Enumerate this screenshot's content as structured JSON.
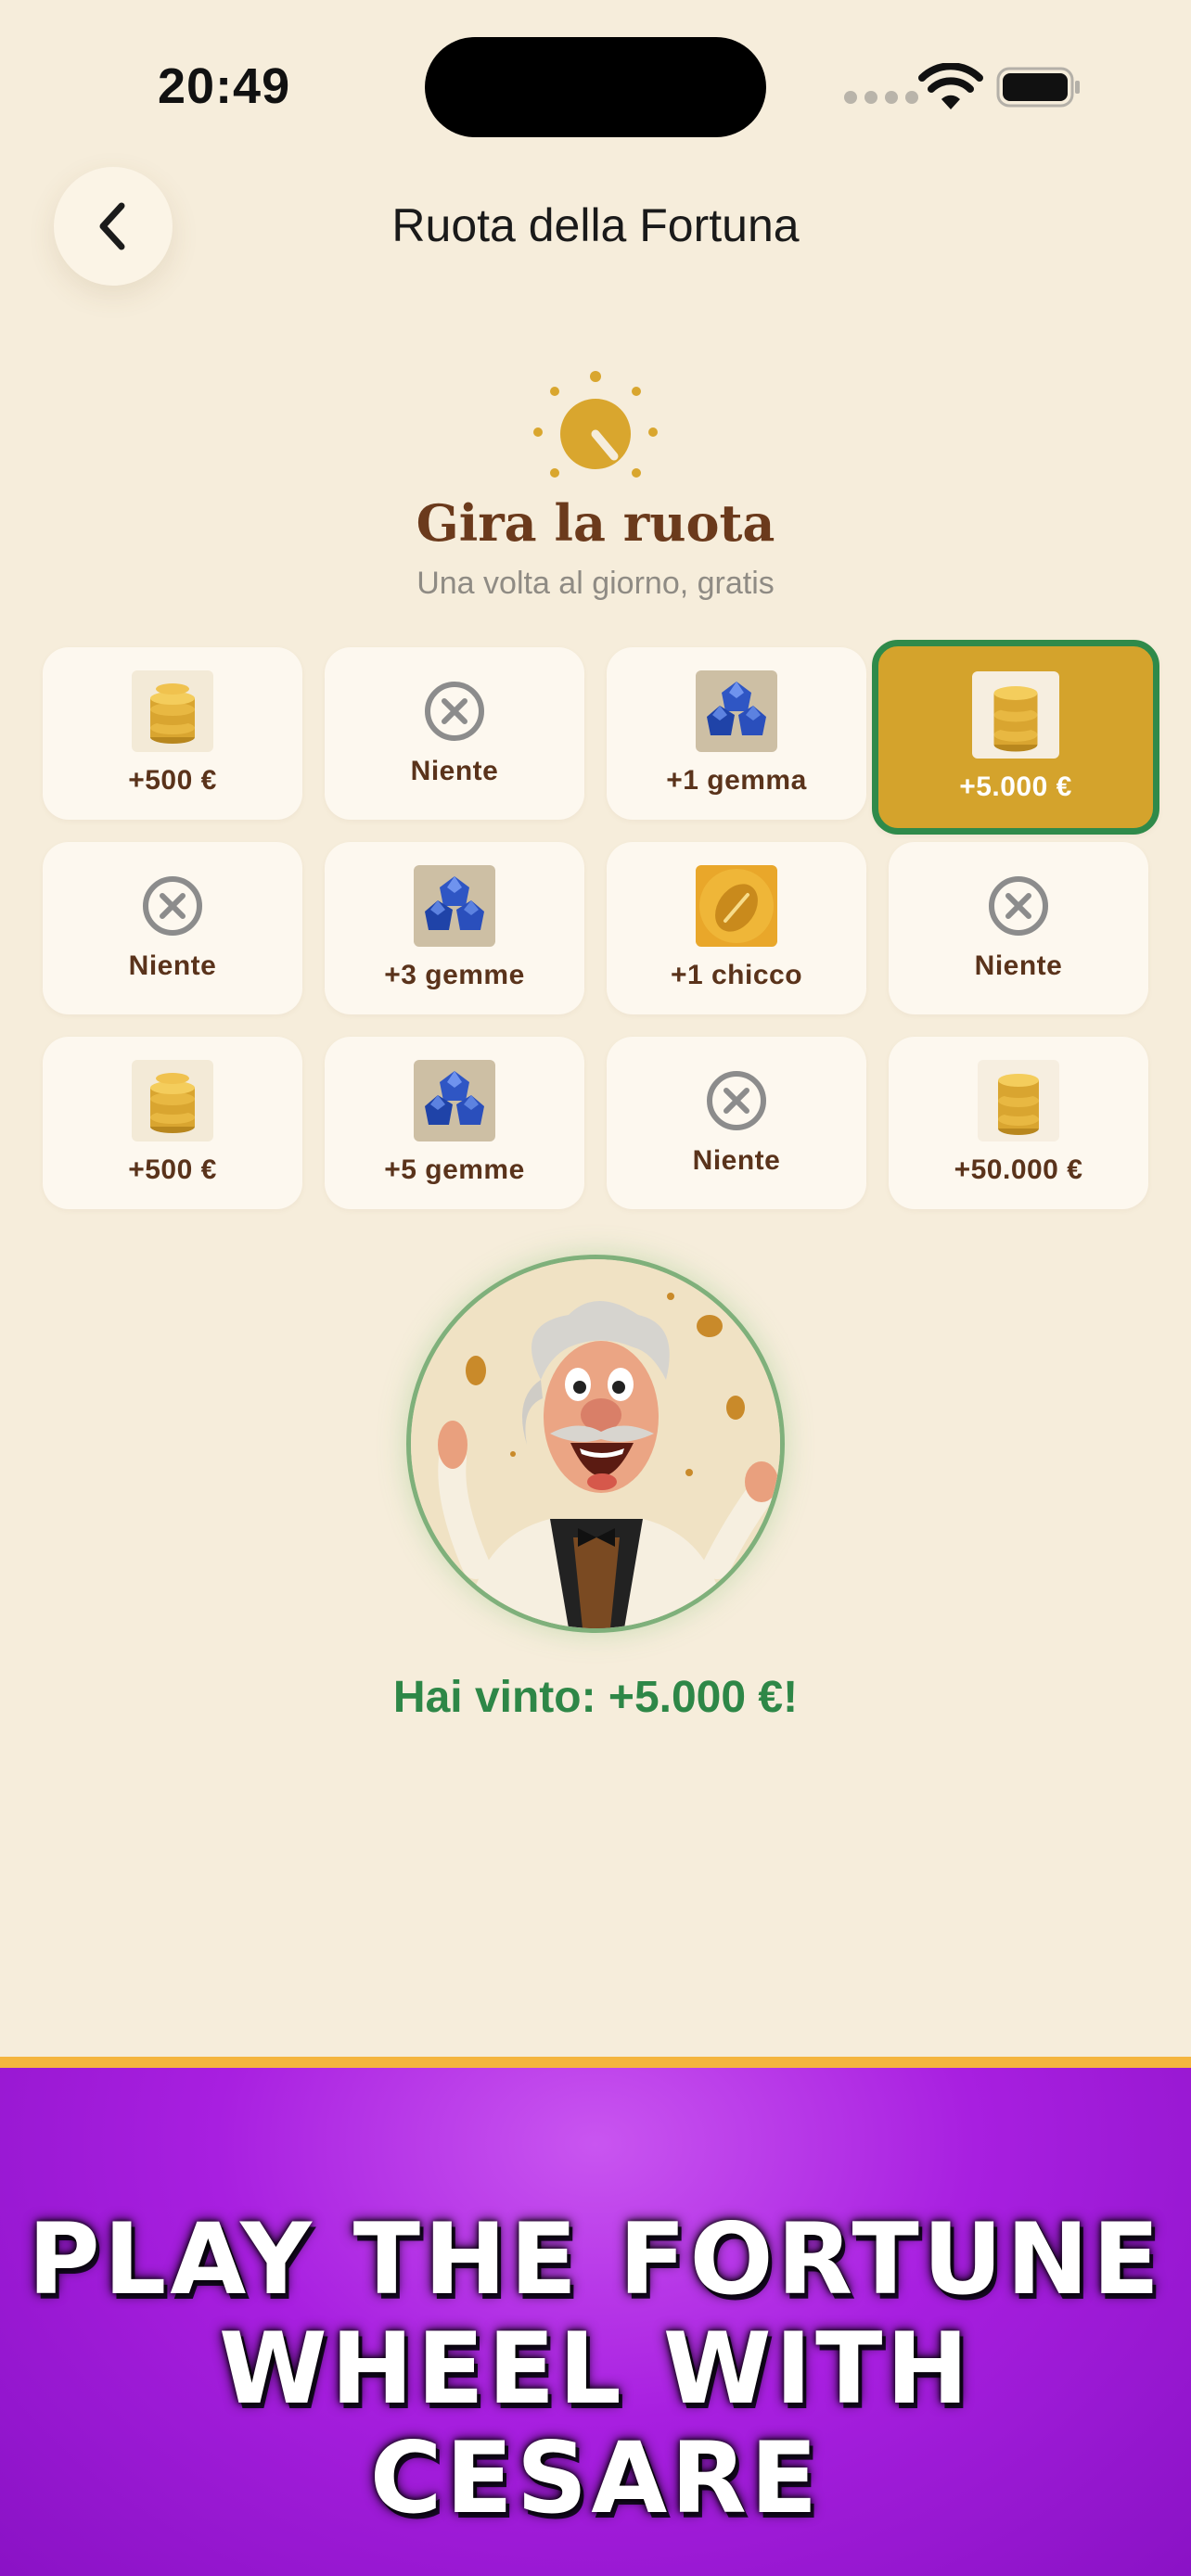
{
  "status_bar": {
    "time": "20:49"
  },
  "nav": {
    "title": "Ruota della Fortuna"
  },
  "hero": {
    "title": "Gira la ruota",
    "subtitle": "Una volta al giorno, gratis"
  },
  "prizes": [
    {
      "label": "+500 €",
      "icon": "coins-icon"
    },
    {
      "label": "Niente",
      "icon": "x-circle-icon"
    },
    {
      "label": "+1 gemma",
      "icon": "gems-icon"
    },
    {
      "label": "+5.000 €",
      "icon": "coins-icon",
      "selected": true
    },
    {
      "label": "Niente",
      "icon": "x-circle-icon"
    },
    {
      "label": "+3 gemme",
      "icon": "gems-icon"
    },
    {
      "label": "+1 chicco",
      "icon": "bean-icon"
    },
    {
      "label": "Niente",
      "icon": "x-circle-icon"
    },
    {
      "label": "+500 €",
      "icon": "coins-icon"
    },
    {
      "label": "+5 gemme",
      "icon": "gems-icon"
    },
    {
      "label": "Niente",
      "icon": "x-circle-icon"
    },
    {
      "label": "+50.000 €",
      "icon": "coins-icon"
    }
  ],
  "result": {
    "text": "Hai vinto: +5.000 €!"
  },
  "banner": {
    "line1": "PLAY THE FORTUNE",
    "line2": "WHEEL WITH CESARE"
  },
  "colors": {
    "background": "#f6eddb",
    "accent_gold": "#d4a32c",
    "win_green": "#2e8747",
    "banner_purple": "#a81fe0"
  }
}
